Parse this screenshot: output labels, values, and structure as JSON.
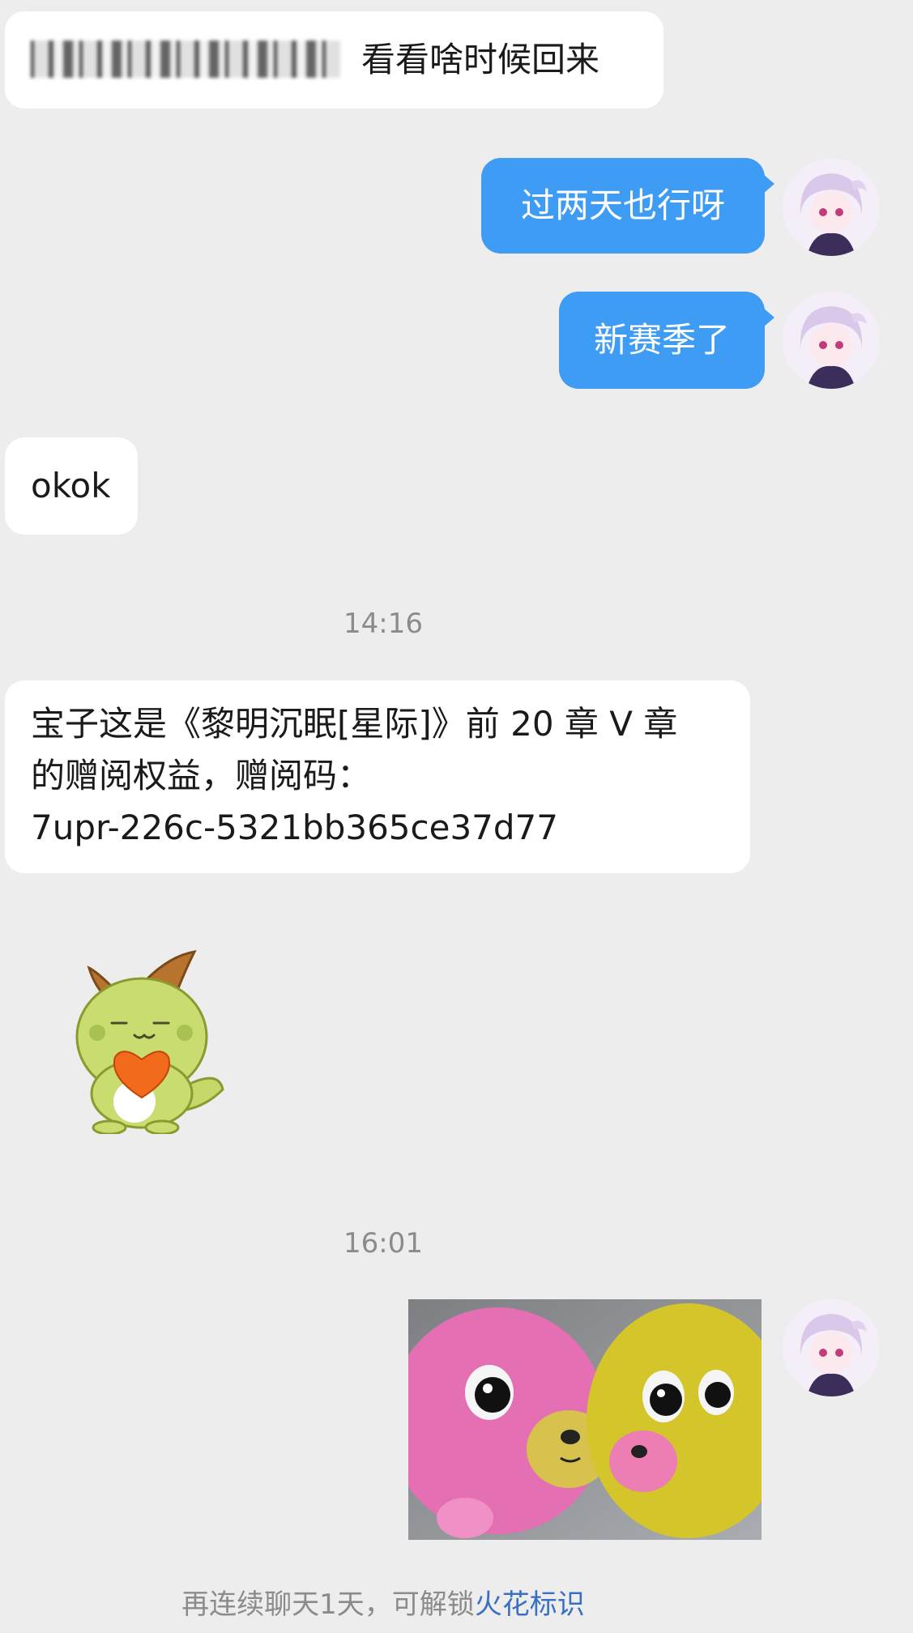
{
  "messages": {
    "m1": {
      "text": "看看啥时候回来"
    },
    "m2": {
      "text": "过两天也行呀"
    },
    "m3": {
      "text": "新赛季了"
    },
    "m4": {
      "text": "okok"
    },
    "m5": {
      "line1": "宝子这是《黎明沉眠[星际]》前 20 章 V 章",
      "line2": "的赠阅权益，赠阅码：",
      "line3": "7upr-226c-5321bb365ce37d77"
    }
  },
  "timestamps": {
    "t1": "14:16",
    "t2": "16:01"
  },
  "footer": {
    "prefix": "再连续聊天1天，可解锁",
    "link": "火花标识"
  },
  "colors": {
    "outgoing_bubble": "#3f9cf4",
    "incoming_bubble": "#ffffff",
    "background": "#ededed",
    "link": "#3b6fc4"
  },
  "icons": {
    "sticker": "green-dragon-heart-sticker",
    "avatar": "anime-girl-avatar",
    "image": "pink-and-yellow-toys-photo"
  }
}
